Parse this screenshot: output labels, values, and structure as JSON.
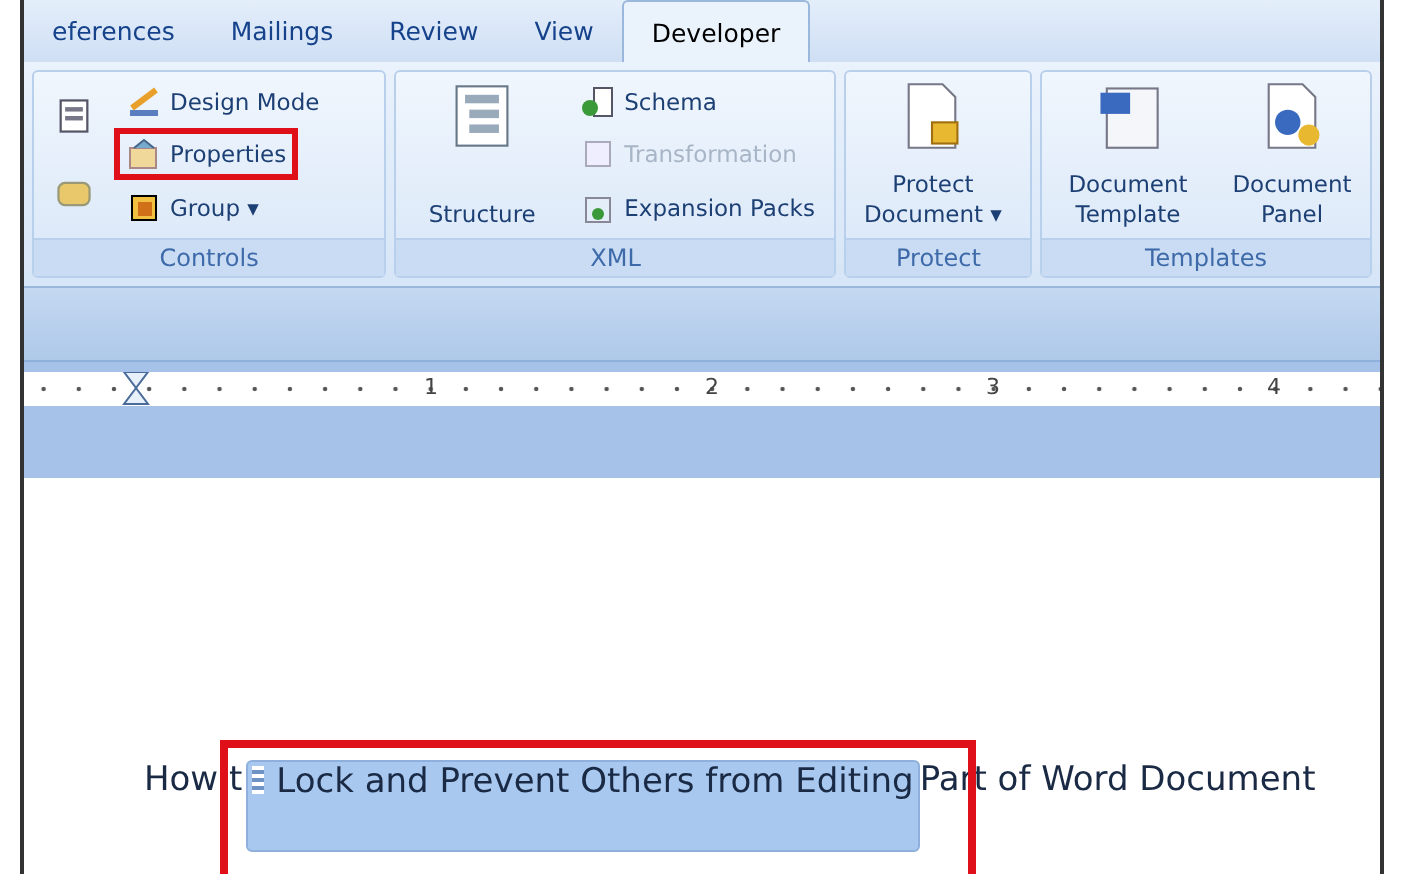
{
  "tabs": [
    {
      "label": "eferences",
      "selected": false
    },
    {
      "label": "Mailings",
      "selected": false
    },
    {
      "label": "Review",
      "selected": false
    },
    {
      "label": "View",
      "selected": false
    },
    {
      "label": "Developer",
      "selected": true
    }
  ],
  "groups": [
    {
      "title": "Controls",
      "items": [
        {
          "kind": "icononly"
        },
        {
          "kind": "small",
          "label": "Design Mode",
          "highlighted": false
        },
        {
          "kind": "icononly"
        },
        {
          "kind": "small",
          "label": "Properties",
          "highlighted": true
        },
        {
          "kind": "small",
          "label": "Group ▾",
          "highlighted": false
        }
      ]
    },
    {
      "title": "XML",
      "items": [
        {
          "kind": "large",
          "label": "Structure"
        },
        {
          "kind": "small",
          "label": "Schema",
          "highlighted": false,
          "disabled": false
        },
        {
          "kind": "small",
          "label": "Transformation",
          "highlighted": false,
          "disabled": true
        },
        {
          "kind": "small",
          "label": "Expansion Packs",
          "highlighted": false,
          "disabled": false
        }
      ]
    },
    {
      "title": "Protect",
      "items": [
        {
          "kind": "large",
          "label": "Protect Document ▾"
        }
      ]
    },
    {
      "title": "Templates",
      "items": [
        {
          "kind": "large",
          "label": "Document Template"
        },
        {
          "kind": "large",
          "label": "Document Panel"
        }
      ]
    }
  ],
  "ruler": {
    "numbers": [
      "1",
      "2",
      "3",
      "4"
    ]
  },
  "document": {
    "before": "How t",
    "control": "Lock and Prevent Others from Editing",
    "after": "Part of Word Document",
    "control_highlighted": true
  }
}
